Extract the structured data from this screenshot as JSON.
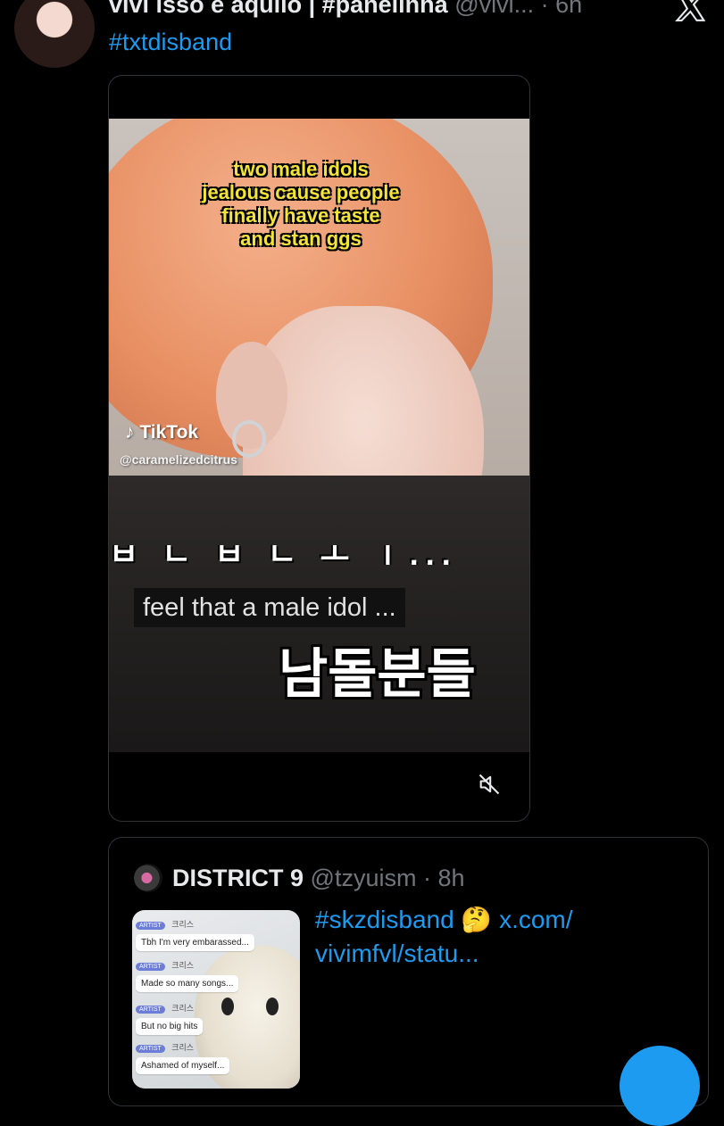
{
  "post": {
    "author_name": "vivi isso e aquilo | #panelinha",
    "author_handle": "@vivi...",
    "separator": "·",
    "time": "6h",
    "hashtag": "#txtdisband"
  },
  "video": {
    "overlay_caption": [
      "two male idols",
      "jealous cause people",
      "finally have taste",
      "and stan ggs"
    ],
    "tiktok_brand": "TikTok",
    "tiktok_user": "@caramelizedcitrus",
    "hangul_partial": "ㅂ ㄴ ㅂ ㄴ ㅗ  ㅣ...",
    "subtitle_en": "feel that a male idol ...",
    "subtitle_ko": "남돌분들",
    "mute_icon": "volume-muted-icon"
  },
  "quote": {
    "author_name": "DISTRICT 9",
    "author_handle": "@tzyuism",
    "separator": "·",
    "time": "8h",
    "text": "#skzdisband 🤔 x.com/ vivimfvl/statu...",
    "thumbnail_chat": [
      {
        "tag": "ARTIST",
        "nick": "크리스",
        "message": "Tbh I'm very embarassed..."
      },
      {
        "tag": "ARTIST",
        "nick": "크리스",
        "message": "Made so many songs..."
      },
      {
        "tag": "ARTIST",
        "nick": "크리스",
        "message": "But no big hits"
      },
      {
        "tag": "ARTIST",
        "nick": "크리스",
        "message": "Ashamed of myself..."
      }
    ]
  },
  "colors": {
    "background": "#000000",
    "text": "#e7e9ea",
    "muted": "#71767b",
    "link": "#1d9bf0",
    "border": "#2f3336"
  }
}
